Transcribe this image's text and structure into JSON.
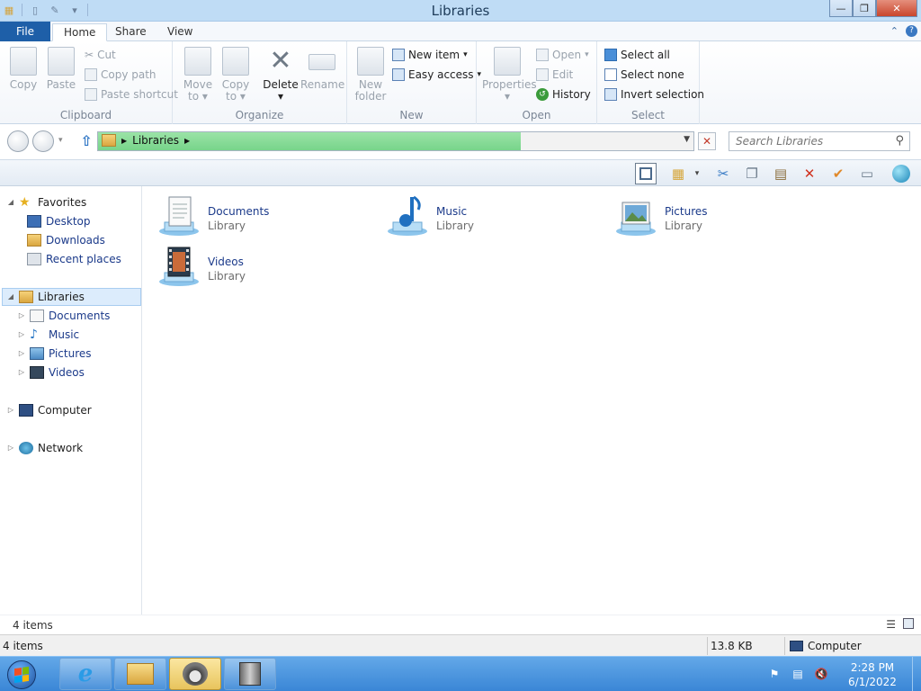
{
  "window": {
    "title": "Libraries"
  },
  "tabs": {
    "file": "File",
    "home": "Home",
    "share": "Share",
    "view": "View"
  },
  "ribbon": {
    "clipboard": {
      "label": "Clipboard",
      "copy": "Copy",
      "paste": "Paste",
      "cut": "Cut",
      "copy_path": "Copy path",
      "paste_shortcut": "Paste shortcut"
    },
    "organize": {
      "label": "Organize",
      "move_to": "Move",
      "move_to2": "to",
      "copy_to": "Copy",
      "copy_to2": "to",
      "delete": "Delete",
      "rename": "Rename"
    },
    "new": {
      "label": "New",
      "new_folder": "New",
      "new_folder2": "folder",
      "new_item": "New item",
      "easy_access": "Easy access"
    },
    "open": {
      "label": "Open",
      "properties": "Properties",
      "open": "Open",
      "edit": "Edit",
      "history": "History"
    },
    "select": {
      "label": "Select",
      "select_all": "Select all",
      "select_none": "Select none",
      "invert_selection": "Invert selection"
    }
  },
  "address": {
    "crumb": "Libraries",
    "search_placeholder": "Search Libraries"
  },
  "nav": {
    "favorites": "Favorites",
    "desktop": "Desktop",
    "downloads": "Downloads",
    "recent": "Recent places",
    "libraries": "Libraries",
    "documents": "Documents",
    "music": "Music",
    "pictures": "Pictures",
    "videos": "Videos",
    "computer": "Computer",
    "network": "Network"
  },
  "libraries": [
    {
      "name": "Documents",
      "type": "Library"
    },
    {
      "name": "Music",
      "type": "Library"
    },
    {
      "name": "Pictures",
      "type": "Library"
    },
    {
      "name": "Videos",
      "type": "Library"
    }
  ],
  "status": {
    "items": "4 items",
    "items_bottom": "4 items",
    "size": "13.8 KB",
    "location": "Computer"
  },
  "clock": {
    "time": "2:28 PM",
    "date": "6/1/2022"
  },
  "colors": {
    "title_bar": "#bfdcf5",
    "file_tab": "#1e5fa8",
    "address_progress": "#77d48a",
    "taskbar": "#3a86d6"
  }
}
